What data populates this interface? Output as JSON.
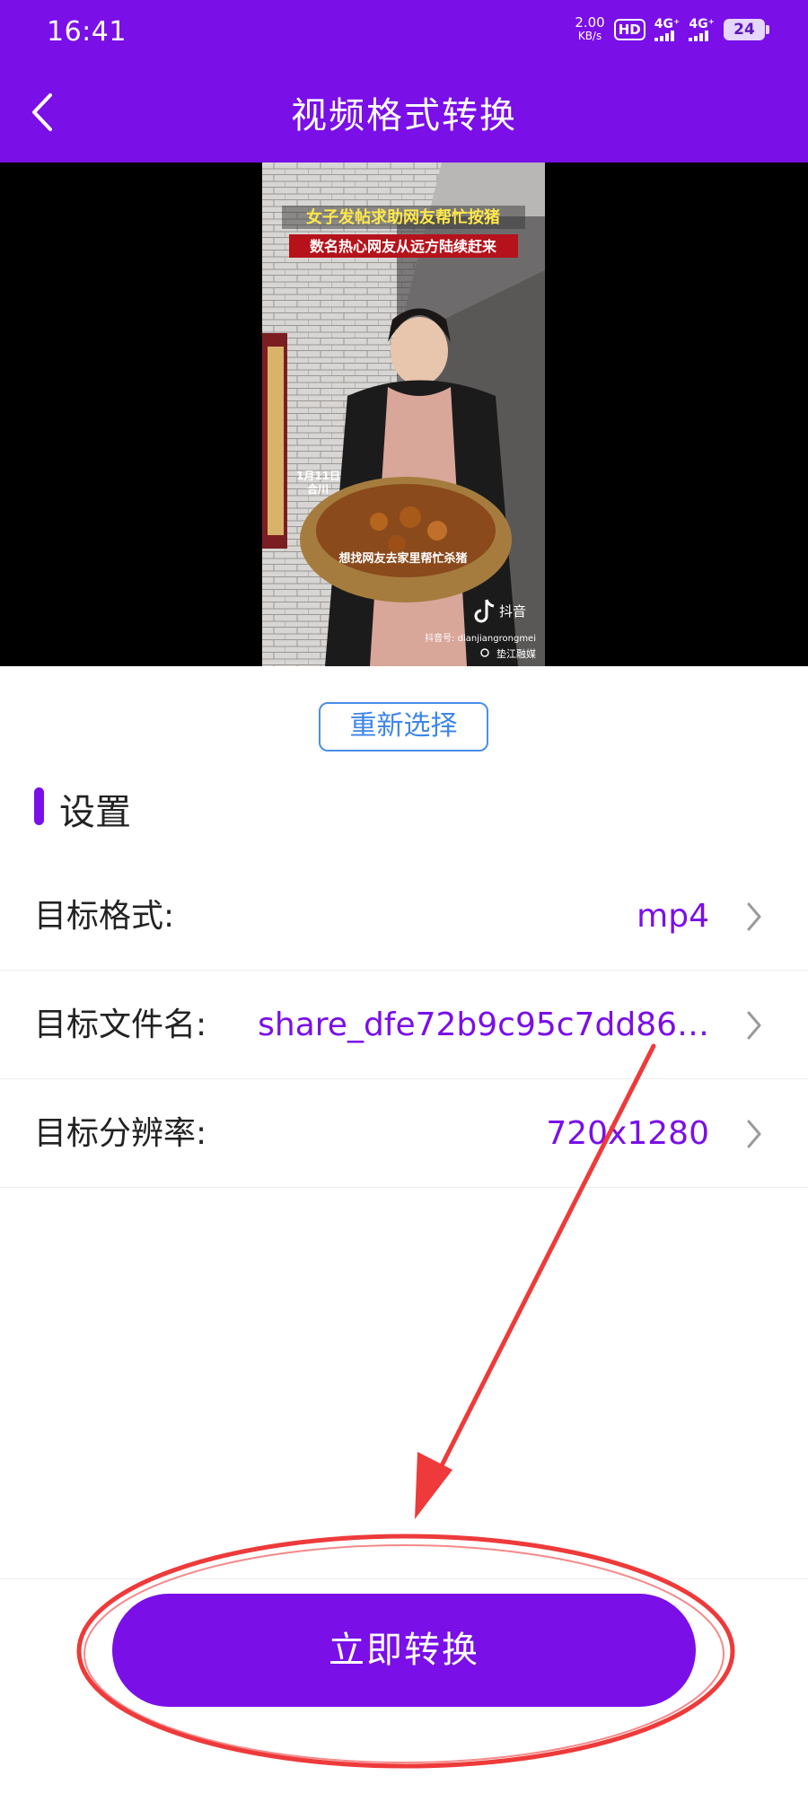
{
  "status_bar": {
    "time": "16:41",
    "speed_value": "2.00",
    "speed_unit": "KB/s",
    "hd_label": "HD",
    "sim1": "4G⁺",
    "sim2": "4G⁺",
    "battery": "24"
  },
  "header": {
    "title": "视频格式转换",
    "back_icon": "chevron-left-icon"
  },
  "video": {
    "headline_1": "女子发帖求助网友帮忙按猪",
    "headline_2": "数名热心网友从远方陆续赶来",
    "date_tag": "1月11日",
    "place_tag": "合川",
    "subtitle": "想找网友去家里帮忙杀猪",
    "platform_logo": "抖音",
    "account_label": "抖音号: dianjiangrongmei",
    "source_label": "垫江融媒"
  },
  "reselect_button": "重新选择",
  "settings": {
    "section_title": "设置",
    "rows": [
      {
        "label": "目标格式:",
        "value": "mp4"
      },
      {
        "label": "目标文件名:",
        "value": "share_dfe72b9c95c7dd86…"
      },
      {
        "label": "目标分辨率:",
        "value": "720x1280"
      }
    ]
  },
  "convert_button": "立即转换",
  "colors": {
    "accent": "#7a0fe8",
    "link": "#3f86e8",
    "annotation": "#ee3a3a"
  }
}
